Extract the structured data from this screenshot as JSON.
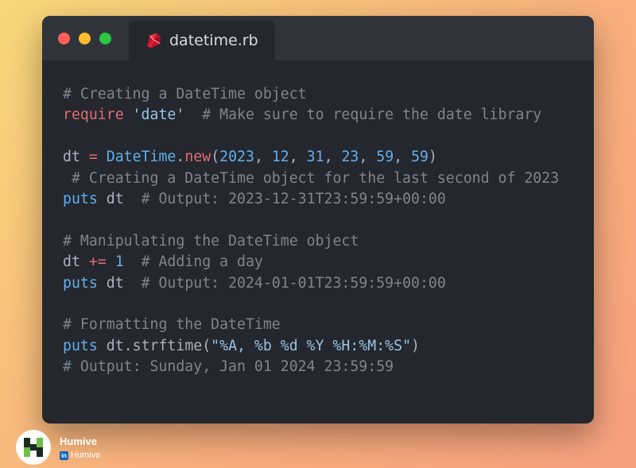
{
  "window": {
    "controls": {
      "close": "#ff5f57",
      "minimize": "#febc2e",
      "maximize": "#28c840"
    },
    "tab": {
      "label": "datetime.rb",
      "icon": "ruby-icon"
    }
  },
  "code": {
    "lines": [
      [
        [
          "# Creating a DateTime object",
          "com"
        ]
      ],
      [
        [
          "require",
          "red"
        ],
        [
          " ",
          "id"
        ],
        [
          "'date'",
          "str"
        ],
        [
          "  ",
          "id"
        ],
        [
          "# Make sure to require the date library",
          "com"
        ]
      ],
      [],
      [
        [
          "dt",
          "id"
        ],
        [
          " ",
          "id"
        ],
        [
          "=",
          "red"
        ],
        [
          " ",
          "id"
        ],
        [
          "DateTime",
          "cls"
        ],
        [
          ".",
          "id"
        ],
        [
          "new",
          "red"
        ],
        [
          "(",
          "id"
        ],
        [
          "2023",
          "num"
        ],
        [
          ", ",
          "id"
        ],
        [
          "12",
          "num"
        ],
        [
          ", ",
          "id"
        ],
        [
          "31",
          "num"
        ],
        [
          ", ",
          "id"
        ],
        [
          "23",
          "num"
        ],
        [
          ", ",
          "id"
        ],
        [
          "59",
          "num"
        ],
        [
          ", ",
          "id"
        ],
        [
          "59",
          "num"
        ],
        [
          ")",
          "id"
        ]
      ],
      [
        [
          " # Creating a DateTime object for the last second of 2023",
          "com"
        ]
      ],
      [
        [
          "puts",
          "fn"
        ],
        [
          " ",
          "id"
        ],
        [
          "dt",
          "id"
        ],
        [
          "  ",
          "id"
        ],
        [
          "# Output: 2023-12-31T23:59:59+00:00",
          "com"
        ]
      ],
      [],
      [
        [
          "# Manipulating the DateTime object",
          "com"
        ]
      ],
      [
        [
          "dt",
          "id"
        ],
        [
          " ",
          "id"
        ],
        [
          "+=",
          "red"
        ],
        [
          " ",
          "id"
        ],
        [
          "1",
          "num"
        ],
        [
          "  ",
          "id"
        ],
        [
          "# Adding a day",
          "com"
        ]
      ],
      [
        [
          "puts",
          "fn"
        ],
        [
          " ",
          "id"
        ],
        [
          "dt",
          "id"
        ],
        [
          "  ",
          "id"
        ],
        [
          "# Output: 2024-01-01T23:59:59+00:00",
          "com"
        ]
      ],
      [],
      [
        [
          "# Formatting the DateTime",
          "com"
        ]
      ],
      [
        [
          "puts",
          "fn"
        ],
        [
          " ",
          "id"
        ],
        [
          "dt.strftime(",
          "id"
        ],
        [
          "\"%A, %b %d %Y %H:%M:%S\"",
          "str"
        ],
        [
          ")",
          "id"
        ]
      ],
      [
        [
          "# Output: Sunday, Jan 01 2024 23:59:59",
          "com"
        ]
      ]
    ]
  },
  "brand": {
    "name": "Humive",
    "linkedin_label": "Humive",
    "linkedin_icon": "in"
  }
}
